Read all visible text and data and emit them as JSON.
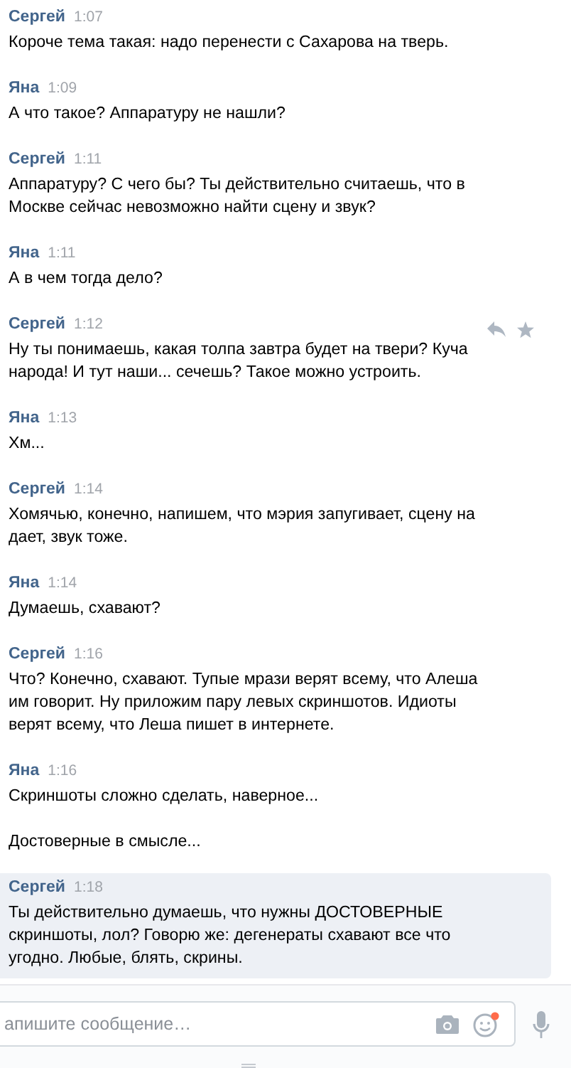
{
  "messages": [
    {
      "author": "Сергей",
      "time": "1:07",
      "paragraphs": [
        "Короче тема такая: надо перенести с Сахарова на тверь."
      ],
      "highlighted": false,
      "actions_visible": false
    },
    {
      "author": "Яна",
      "time": "1:09",
      "paragraphs": [
        "А что такое? Аппаратуру не нашли?"
      ],
      "highlighted": false,
      "actions_visible": false
    },
    {
      "author": "Сергей",
      "time": "1:11",
      "paragraphs": [
        "Аппаратуру? С чего бы? Ты действительно считаешь, что в Москве сейчас невозможно найти сцену и звук?"
      ],
      "highlighted": false,
      "actions_visible": false
    },
    {
      "author": "Яна",
      "time": "1:11",
      "paragraphs": [
        "А в чем тогда дело?"
      ],
      "highlighted": false,
      "actions_visible": false
    },
    {
      "author": "Сергей",
      "time": "1:12",
      "paragraphs": [
        "Ну ты понимаешь, какая толпа завтра будет на твери? Куча народа! И тут наши... сечешь? Такое можно устроить."
      ],
      "highlighted": false,
      "actions_visible": true
    },
    {
      "author": "Яна",
      "time": "1:13",
      "paragraphs": [
        "Хм..."
      ],
      "highlighted": false,
      "actions_visible": false
    },
    {
      "author": "Сергей",
      "time": "1:14",
      "paragraphs": [
        "Хомячью, конечно, напишем, что мэрия запугивает, сцену на дает, звук тоже."
      ],
      "highlighted": false,
      "actions_visible": false
    },
    {
      "author": "Яна",
      "time": "1:14",
      "paragraphs": [
        "Думаешь, схавают?"
      ],
      "highlighted": false,
      "actions_visible": false
    },
    {
      "author": "Сергей",
      "time": "1:16",
      "paragraphs": [
        "Что? Конечно, схавают. Тупые мрази верят всему, что Алеша им говорит. Ну приложим пару левых скриншотов. Идиоты верят всему, что Леша пишет в интернете."
      ],
      "highlighted": false,
      "actions_visible": false
    },
    {
      "author": "Яна",
      "time": "1:16",
      "paragraphs": [
        "Скриншоты сложно сделать, наверное...",
        "Достоверные в смысле..."
      ],
      "highlighted": false,
      "actions_visible": false
    },
    {
      "author": "Сергей",
      "time": "1:18",
      "paragraphs": [
        "Ты действительно думаешь, что нужны ДОСТОВЕРНЫЕ скриншоты, лол? Говорю же: дегенераты схавают все что угодно. Любые, блять, скрины."
      ],
      "highlighted": true,
      "actions_visible": false
    }
  ],
  "composer": {
    "placeholder": "апишите сообщение…",
    "emoji_notification": true
  }
}
